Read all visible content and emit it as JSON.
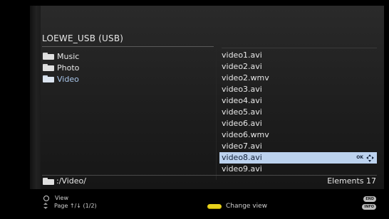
{
  "device": {
    "title": "LOEWE_USB (USB)"
  },
  "folders": [
    {
      "label": "Music",
      "icon": "folder-icon",
      "active": false
    },
    {
      "label": "Photo",
      "icon": "folder-icon",
      "active": false
    },
    {
      "label": "Video",
      "icon": "folder-icon",
      "active": true
    }
  ],
  "files": [
    "video1.avi",
    "video2.avi",
    "video2.wmv",
    "video3.avi",
    "video4.avi",
    "video5.avi",
    "video6.avi",
    "video6.wmv",
    "video7.avi",
    "video8.avi",
    "video9.avi"
  ],
  "selected_file_index": 9,
  "selection_icons": {
    "ok": "OK",
    "nav": "dpad-icon"
  },
  "path": {
    "label": ":/Video/",
    "icon": "folder-icon"
  },
  "elements_label": "Elements 17",
  "footer": {
    "view_label": "View",
    "page_label": "Page ↑/↓ (1/2)",
    "change_view_label": "Change view",
    "end_key": "END",
    "info_key": "INFO"
  },
  "colors": {
    "selection": "#bcd2ee",
    "active_folder": "#a9c6ea",
    "yellow_key": "#e8d21c"
  }
}
